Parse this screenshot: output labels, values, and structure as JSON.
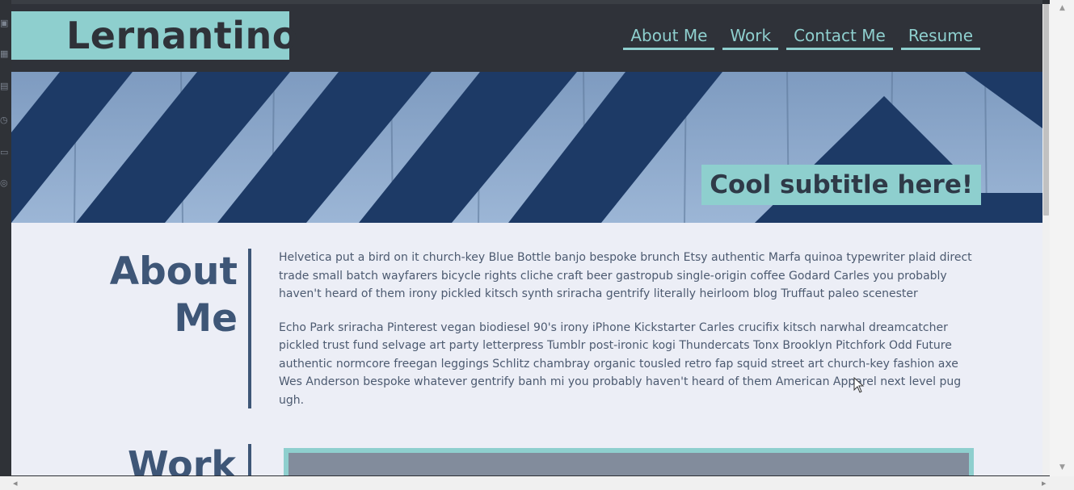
{
  "site": {
    "logo": "Lernantino",
    "nav": [
      "About Me",
      "Work",
      "Contact Me",
      "Resume"
    ],
    "subtitle": "Cool subtitle here!"
  },
  "about": {
    "heading_line1": "About",
    "heading_line2": "Me",
    "paragraphs": [
      "Helvetica put a bird on it church-key Blue Bottle banjo bespoke brunch Etsy authentic Marfa quinoa typewriter plaid direct trade small batch wayfarers bicycle rights cliche craft beer gastropub single-origin coffee Godard Carles you probably haven't heard of them irony pickled kitsch synth sriracha gentrify literally heirloom blog Truffaut paleo scenester",
      "Echo Park sriracha Pinterest vegan biodiesel 90's irony iPhone Kickstarter Carles crucifix kitsch narwhal dreamcatcher pickled trust fund selvage art party letterpress Tumblr post-ironic kogi Thundercats Tonx Brooklyn Pitchfork Odd Future authentic normcore freegan leggings Schlitz chambray organic tousled retro fap squid street art church-key fashion axe Wes Anderson bespoke whatever gentrify banh mi you probably haven't heard of them American Apparel next level pug ugh."
    ]
  },
  "work": {
    "heading": "Work"
  },
  "colors": {
    "accent": "#8ecfce",
    "header_bg": "#2f3239",
    "heading": "#3e5677",
    "page_bg": "#eceef6"
  }
}
